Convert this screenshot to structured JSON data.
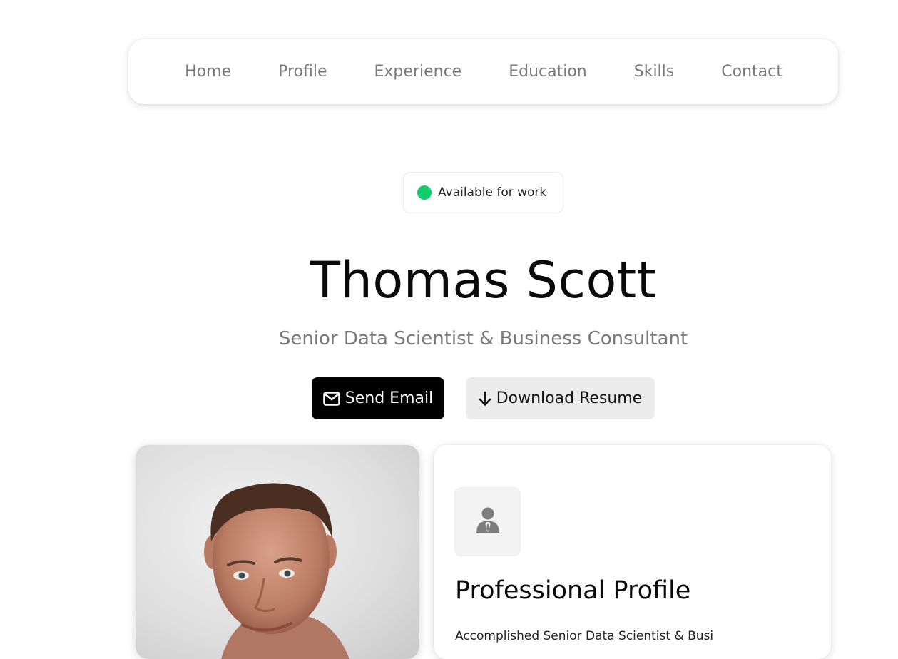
{
  "nav": {
    "items": [
      "Home",
      "Profile",
      "Experience",
      "Education",
      "Skills",
      "Contact"
    ]
  },
  "status": {
    "label": "Available for work",
    "color": "#12cc6b"
  },
  "hero": {
    "name": "Thomas Scott",
    "title": "Senior Data Scientist & Business Consultant"
  },
  "actions": {
    "email_label": "Send Email",
    "email_icon": "envelope-icon",
    "resume_label": "Download Resume",
    "resume_icon": "arrow-down-icon"
  },
  "profile": {
    "icon": "user-tie-icon",
    "heading": "Professional Profile",
    "text": "Accomplished Senior Data Scientist & Busi"
  },
  "colors": {
    "primary_button": "#000000",
    "secondary_button": "#ececec",
    "nav_text": "#7a7a7a"
  }
}
